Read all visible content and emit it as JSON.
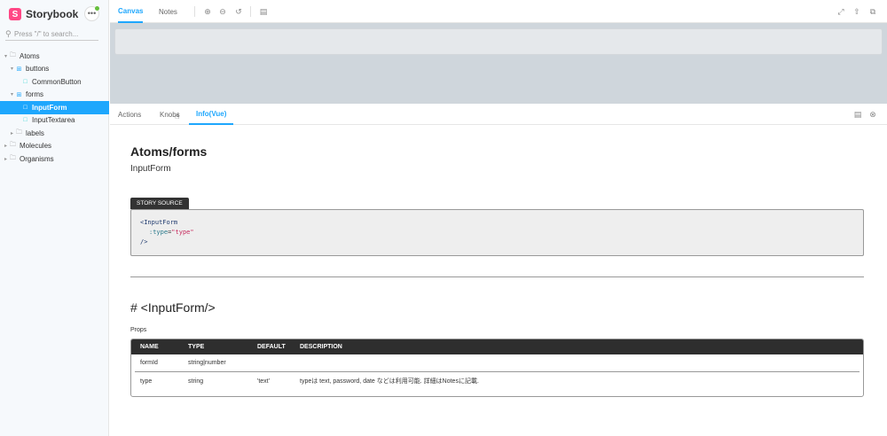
{
  "brand": {
    "name": "Storybook",
    "logo_letter": "S"
  },
  "search": {
    "placeholder": "Press \"/\" to search..."
  },
  "tree": [
    {
      "label": "Atoms",
      "type": "folder",
      "depth": 0,
      "expanded": true
    },
    {
      "label": "buttons",
      "type": "component",
      "depth": 1,
      "expanded": true
    },
    {
      "label": "CommonButton",
      "type": "story",
      "depth": 2
    },
    {
      "label": "forms",
      "type": "component",
      "depth": 1,
      "expanded": true
    },
    {
      "label": "InputForm",
      "type": "story",
      "depth": 2,
      "selected": true
    },
    {
      "label": "InputTextarea",
      "type": "story",
      "depth": 2
    },
    {
      "label": "labels",
      "type": "folder",
      "depth": 1,
      "expanded": false
    },
    {
      "label": "Molecules",
      "type": "folder",
      "depth": 0,
      "expanded": false
    },
    {
      "label": "Organisms",
      "type": "folder",
      "depth": 0,
      "expanded": false
    }
  ],
  "toolbar": {
    "tabs": [
      "Canvas",
      "Notes"
    ],
    "icons": [
      "zoom-in-icon",
      "zoom-out-icon",
      "zoom-reset-icon",
      "background-icon",
      "fullscreen-icon",
      "share-icon",
      "copy-icon"
    ]
  },
  "addons": {
    "tabs": [
      "Actions",
      "Knobs",
      "Info(Vue)"
    ],
    "icons": [
      "panel-toggle-icon",
      "close-icon"
    ]
  },
  "info": {
    "title": "Atoms/forms",
    "subtitle": "InputForm",
    "story_source_label": "STORY SOURCE",
    "code": {
      "line1": "<InputForm",
      "attr": ":type",
      "eq": "=",
      "value": "\"type\"",
      "line3": "/>"
    },
    "component_heading": "# <InputForm/>",
    "props_label": "Props",
    "props_table": {
      "headers": [
        "NAME",
        "TYPE",
        "DEFAULT",
        "DESCRIPTION"
      ],
      "rows": [
        [
          "formId",
          "string|number",
          "",
          ""
        ],
        [
          "type",
          "string",
          "'text'",
          "typeは text, password, date などは利用可能. 詳細はNotesに記載."
        ]
      ]
    }
  },
  "colors": {
    "accent": "#1ea7fd",
    "brand": "#ff4785",
    "canvas_bg": "#cfd6dc"
  }
}
